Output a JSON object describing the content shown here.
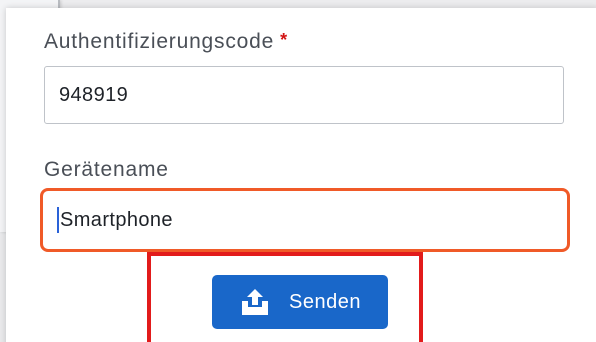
{
  "form": {
    "auth_code": {
      "label": "Authentifizierungscode",
      "required_marker": "*",
      "value": "948919"
    },
    "device_name": {
      "label": "Gerätename",
      "value": "Smartphone",
      "focused": true
    },
    "submit": {
      "label": "Senden",
      "icon": "upload-tray-icon"
    }
  },
  "colors": {
    "button_bg": "#1967c9",
    "focus_border": "#f05a28",
    "highlight_border": "#e21b1b",
    "required_star": "#d21414",
    "label_text": "#4a4f57"
  }
}
